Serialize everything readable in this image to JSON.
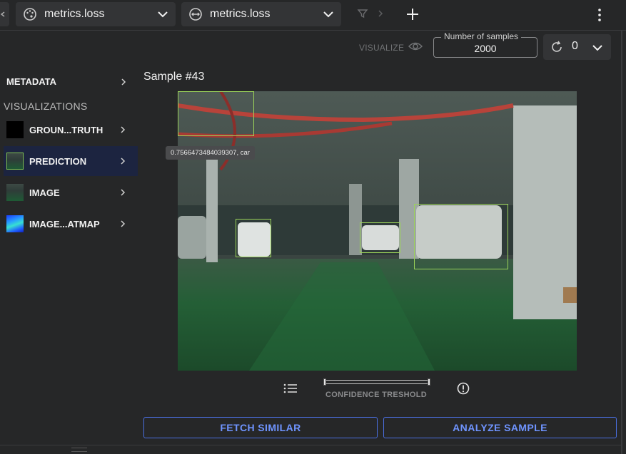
{
  "toolbar": {
    "metric_a": {
      "icon": "palette-icon",
      "label": "metrics.loss"
    },
    "metric_b": {
      "icon": "arrows-horizontal-icon",
      "label": "metrics.loss"
    }
  },
  "controls": {
    "visualize_label": "VISUALIZE",
    "samples_legend": "Number of samples",
    "samples_value": "2000",
    "refresh_count": "0"
  },
  "sidebar": {
    "metadata_label": "METADATA",
    "visualizations_label": "VISUALIZATIONS",
    "items": [
      {
        "label": "GROUN...TRUTH",
        "thumb": "black"
      },
      {
        "label": "PREDICTION",
        "thumb": "scene",
        "active": true
      },
      {
        "label": "IMAGE",
        "thumb": "scene"
      },
      {
        "label": "IMAGE...ATMAP",
        "thumb": "heatmap"
      }
    ]
  },
  "main": {
    "sample_title": "Sample #43",
    "tooltip": "0.7566473484039307, car",
    "confidence_label": "CONFIDENCE TRESHOLD",
    "fetch_similar": "FETCH SIMILAR",
    "analyze_sample": "ANALYZE SAMPLE"
  },
  "colors": {
    "accent": "#4a6fe0",
    "bbox": "#9bd35a",
    "active_item": "#1c2440"
  }
}
